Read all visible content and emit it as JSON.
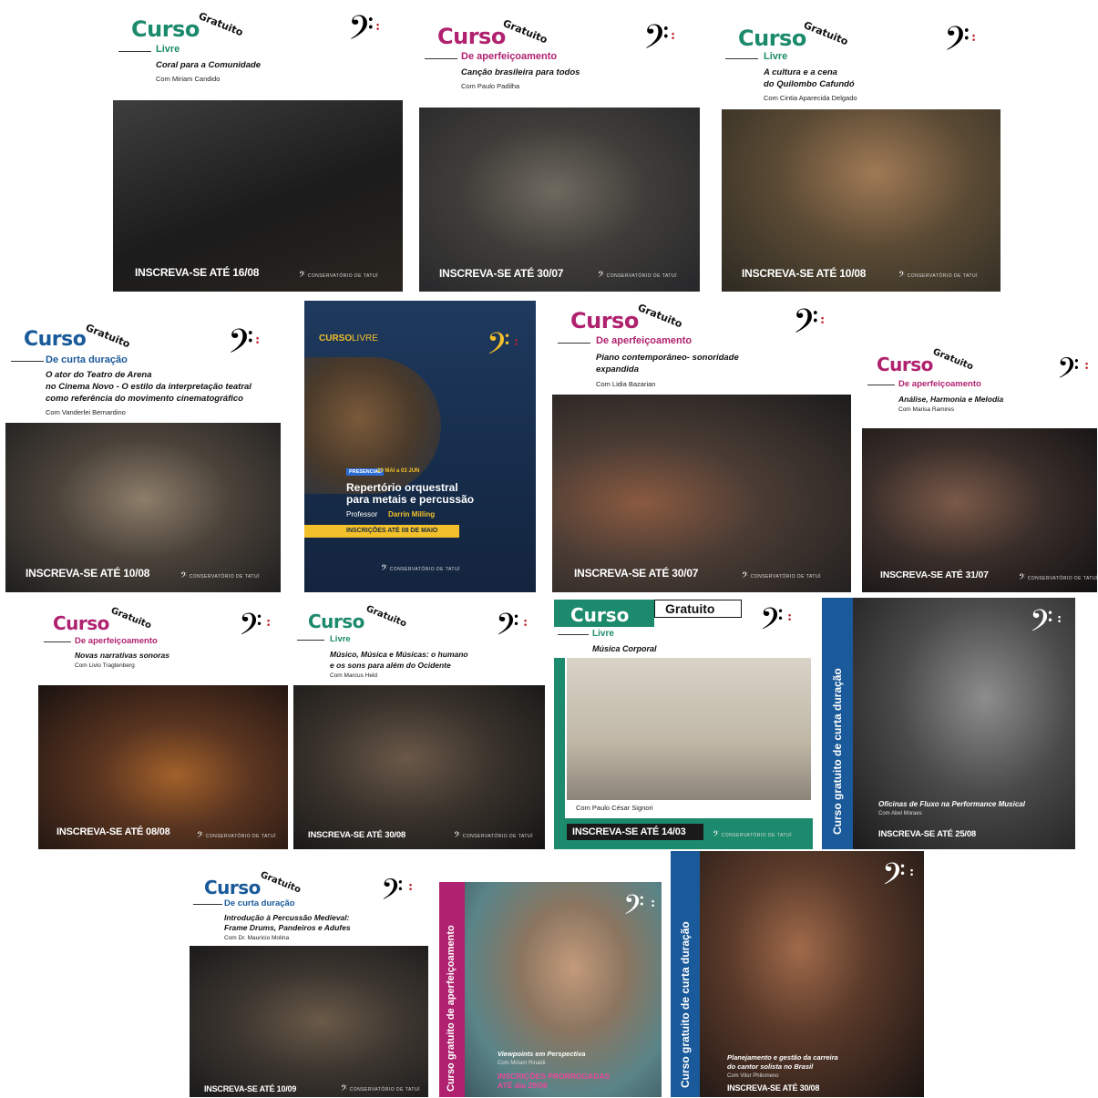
{
  "colors": {
    "green": "#1c8a6c",
    "magenta": "#b0226f",
    "blue": "#1a5a9a",
    "navy": "#16355e",
    "gold": "#f2c02a",
    "clefred": "#c0202a"
  },
  "common": {
    "curso": "Curso",
    "gratuito": "Gratuito",
    "logo_text": "CONSERVATÓRIO DE TATUÍ",
    "clef_icon": "bass-clef-icon"
  },
  "cards": [
    {
      "type": "Livre",
      "title": "Coral para a Comunidade",
      "teacher": "Com Miriam Candido",
      "insc": "INSCREVA-SE ATÉ 16/08"
    },
    {
      "type": "De aperfeiçoamento",
      "title": "Canção brasileira para todos",
      "teacher": "Com Paulo Padilha",
      "insc": "INSCREVA-SE ATÉ 30/07"
    },
    {
      "type": "Livre",
      "title1": "A cultura e a cena",
      "title2": "do Quilombo Cafundó",
      "teacher": "Com Cintia Aparecida Delgado",
      "insc": "INSCREVA-SE ATÉ 10/08"
    },
    {
      "type": "De curta duração",
      "title1": "O ator do Teatro de Arena",
      "title2": "no Cinema Novo - O estilo da interpretação teatral",
      "title3": "como referência do movimento cinematográfico",
      "teacher": "Com Vanderlei Bernardino",
      "insc": "INSCREVA-SE ATÉ 10/08"
    },
    {
      "label_a": "CURSO",
      "label_b": "LIVRE",
      "badge": "PRESENCIAL",
      "dates": "29 MAI a 03 JUN",
      "title1": "Repertório orquestral",
      "title2": "para metais e percussão",
      "prof_a": "Professor",
      "prof_b": "Darrin Milling",
      "insc": "INSCRIÇÕES ATÉ 08 DE MAIO"
    },
    {
      "type": "De aperfeiçoamento",
      "title1": "Piano contemporâneo- sonoridade",
      "title2": "expandida",
      "teacher": "Com Lidia Bazarian",
      "insc": "INSCREVA-SE ATÉ 30/07"
    },
    {
      "type": "De aperfeiçoamento",
      "title": "Análise, Harmonia e Melodia",
      "teacher": "Com Marisa Ramires",
      "insc": "INSCREVA-SE ATÉ 31/07"
    },
    {
      "type": "De aperfeiçoamento",
      "title": "Novas narrativas sonoras",
      "teacher": "Com Livio Tragtenberg",
      "insc": "INSCREVA-SE ATÉ 08/08"
    },
    {
      "type": "Livre",
      "title1": "Músico, Música e Músicas: o humano",
      "title2": "e os sons para além do Ocidente",
      "teacher": "Com Marcus Held",
      "insc": "INSCREVA-SE ATÉ 30/08"
    },
    {
      "type": "Livre",
      "title": "Música Corporal",
      "teacher": "Com Paulo César Signori",
      "insc": "INSCREVA-SE ATÉ 14/03"
    },
    {
      "vertical": "Curso gratuito de curta duração",
      "title": "Oficinas de Fluxo na Performance Musical",
      "teacher": "Com Abel Moraes",
      "insc": "INSCREVA-SE ATÉ 25/08"
    },
    {
      "type": "De curta duração",
      "title1": "Introdução à Percussão Medieval:",
      "title2": "Frame Drums, Pandeiros e Adufes",
      "teacher": "Com Dr. Mauricio Molina",
      "insc": "INSCREVA-SE ATÉ 10/09"
    },
    {
      "vertical": "Curso gratuito de aperfeiçoamento",
      "title": "Viewpoints em Perspectiva",
      "teacher": "Com Miriam Rinaldi",
      "insc1": "INSCRIÇÕES PRORROGADAS",
      "insc2": "ATÉ dia 29/08"
    },
    {
      "vertical": "Curso gratuito de curta duração",
      "title1": "Planejamento e gestão da carreira",
      "title2": "do cantor solista no Brasil",
      "teacher": "Com Vitor Philomeno",
      "insc": "INSCREVA-SE ATÉ 30/08"
    }
  ]
}
